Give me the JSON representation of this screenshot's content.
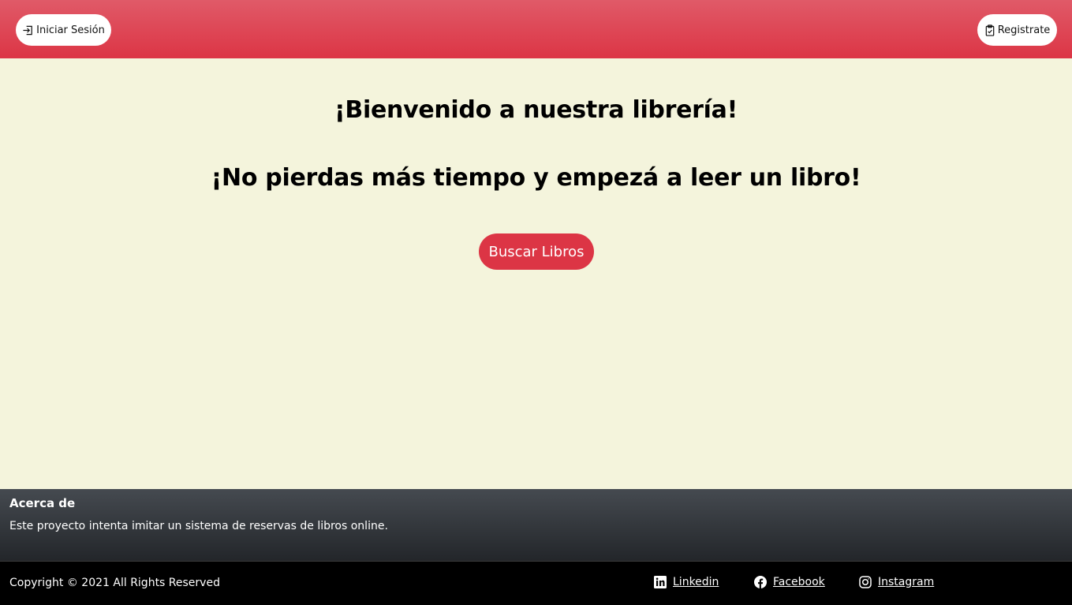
{
  "header": {
    "login_label": "Iniciar Sesión",
    "login_icon": "login-icon",
    "register_label": "Registrate",
    "register_icon": "clipboard-check-icon",
    "accent_color": "#dc3545"
  },
  "main": {
    "headline_1": "¡Bienvenido a nuestra librería!",
    "headline_2": "¡No pierdas más tiempo y empezá a leer un libro!",
    "cta_label": "Buscar Libros",
    "background_color": "#f4f4dc"
  },
  "about": {
    "title": "Acerca de",
    "text": "Este proyecto intenta imitar un sistema de reservas de libros online."
  },
  "footer": {
    "copyright": "Copyright © 2021 All Rights Reserved",
    "social": [
      {
        "label": "Linkedin",
        "icon": "linkedin-icon"
      },
      {
        "label": "Facebook",
        "icon": "facebook-icon"
      },
      {
        "label": "Instagram",
        "icon": "instagram-icon"
      }
    ]
  }
}
